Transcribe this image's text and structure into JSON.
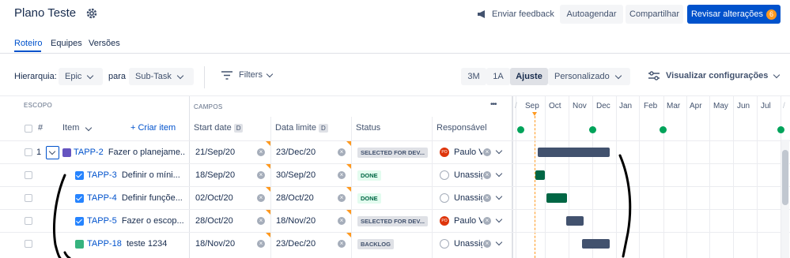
{
  "header": {
    "title": "Plano Teste",
    "feedback": "Enviar feedback",
    "autoschedule": "Autoagendar",
    "share": "Compartilhar",
    "review": "Revisar alterações",
    "review_count": "6"
  },
  "tabs": [
    "Roteiro",
    "Equipes",
    "Versões"
  ],
  "controls": {
    "hierarchy_label": "Hierarquia:",
    "from": "Epic",
    "to_label": "para",
    "to": "Sub-Task",
    "filters": "Filters",
    "zoom": [
      "3M",
      "1A",
      "Ajuste",
      "Personalizado"
    ],
    "view_settings": "Visualizar configurações"
  },
  "columns": {
    "scope": "ESCOPO",
    "fields": "CAMPOS",
    "num": "#",
    "item": "Item",
    "create": "+ Criar item",
    "start": "Start date",
    "due": "Data limite",
    "status": "Status",
    "assignee": "Responsável",
    "d": "D",
    "more": "•••"
  },
  "months": [
    "Sep",
    "Oct",
    "Nov",
    "Dec",
    "Jan",
    "Feb",
    "Mar",
    "Apr",
    "May",
    "Jun",
    "Jul"
  ],
  "rows": [
    {
      "num": "1",
      "key": "TAPP-2",
      "title": "Fazer o planejame...",
      "start": "21/Sep/20",
      "due": "23/Dec/20",
      "status": "SELECTED FOR DEV...",
      "assignee": "Paulo V",
      "type": "epic"
    },
    {
      "num": "",
      "key": "TAPP-3",
      "title": "Definir o míni...",
      "start": "18/Sep/20",
      "due": "30/Sep/20",
      "status": "DONE",
      "assignee": "Unassigne",
      "type": "task"
    },
    {
      "num": "",
      "key": "TAPP-4",
      "title": "Definir funçõe...",
      "start": "02/Oct/20",
      "due": "28/Oct/20",
      "status": "DONE",
      "assignee": "Unassigne",
      "type": "task"
    },
    {
      "num": "",
      "key": "TAPP-5",
      "title": "Fazer o escop...",
      "start": "28/Oct/20",
      "due": "18/Nov/20",
      "status": "SELECTED FOR DEV...",
      "assignee": "Paulo V",
      "type": "task"
    },
    {
      "num": "",
      "key": "TAPP-18",
      "title": "teste 1234",
      "start": "18/Nov/20",
      "due": "23/Dec/20",
      "status": "BACKLOG",
      "assignee": "Unassigne",
      "type": "story"
    }
  ],
  "colors": {
    "primary": "#0052cc",
    "done": "#00a35a",
    "bar": "#42526e",
    "bar_done": "#006644"
  }
}
